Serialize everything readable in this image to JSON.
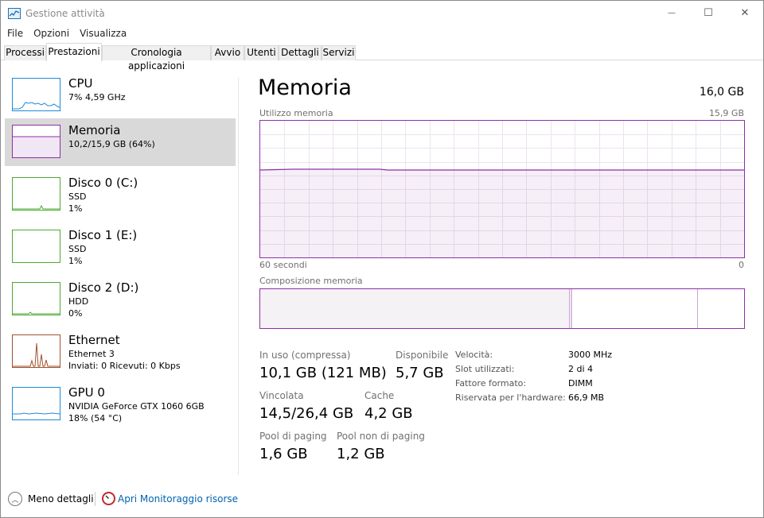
{
  "window": {
    "title": "Gestione attività",
    "controls": {
      "minimize": "—",
      "maximize": "☐",
      "close": "✕"
    }
  },
  "menu": [
    "File",
    "Opzioni",
    "Visualizza"
  ],
  "tabs": [
    {
      "label": "Processi",
      "active": false
    },
    {
      "label": "Prestazioni",
      "active": true
    },
    {
      "label": "Cronologia applicazioni",
      "active": false
    },
    {
      "label": "Avvio",
      "active": false
    },
    {
      "label": "Utenti",
      "active": false
    },
    {
      "label": "Dettagli",
      "active": false
    },
    {
      "label": "Servizi",
      "active": false
    }
  ],
  "sidebar": {
    "items": [
      {
        "name": "cpu",
        "title": "CPU",
        "line1": "7% 4,59 GHz",
        "line2": "",
        "line3": "",
        "color": "#1f8ad6",
        "selected": false
      },
      {
        "name": "memory",
        "title": "Memoria",
        "line1": "10,2/15,9 GB (64%)",
        "line2": "",
        "line3": "",
        "color": "#8e2ea6",
        "selected": true,
        "usage_fraction": 0.64
      },
      {
        "name": "disk-0",
        "title": "Disco 0 (C:)",
        "line1": "SSD",
        "line2": "1%",
        "line3": "",
        "color": "#4ca832",
        "selected": false
      },
      {
        "name": "disk-1",
        "title": "Disco 1 (E:)",
        "line1": "SSD",
        "line2": "1%",
        "line3": "",
        "color": "#4ca832",
        "selected": false
      },
      {
        "name": "disk-2",
        "title": "Disco 2 (D:)",
        "line1": "HDD",
        "line2": "0%",
        "line3": "",
        "color": "#4ca832",
        "selected": false
      },
      {
        "name": "ethernet",
        "title": "Ethernet",
        "line1": "Ethernet 3",
        "line2": "Inviati: 0 Ricevuti: 0 Kbps",
        "line3": "",
        "color": "#a0522d",
        "selected": false
      },
      {
        "name": "gpu-0",
        "title": "GPU 0",
        "line1": "NVIDIA GeForce GTX 1060 6GB",
        "line2": "18% (54 °C)",
        "line3": "",
        "color": "#1f8ad6",
        "selected": false
      }
    ]
  },
  "main": {
    "title": "Memoria",
    "total": "16,0 GB",
    "graph": {
      "label": "Utilizzo memoria",
      "max_label": "15,9 GB",
      "x_left_label": "60 secondi",
      "x_right_label": "0",
      "usage_fraction": 0.64,
      "color": "#8e2ea6"
    },
    "composition": {
      "label": "Composizione memoria",
      "in_use_fraction": 0.64,
      "modified_fraction": 0.004,
      "standby_fraction": 0.26
    },
    "stats": {
      "in_use_label": "In uso (compressa)",
      "in_use_value": "10,1 GB (121 MB)",
      "available_label": "Disponibile",
      "available_value": "5,7 GB",
      "committed_label": "Vincolata",
      "committed_value": "14,5/26,4 GB",
      "cached_label": "Cache",
      "cached_value": "4,2 GB",
      "paged_label": "Pool di paging",
      "paged_value": "1,6 GB",
      "nonpaged_label": "Pool non di paging",
      "nonpaged_value": "1,2 GB"
    },
    "info": [
      {
        "label": "Velocità:",
        "value": "3000 MHz"
      },
      {
        "label": "Slot utilizzati:",
        "value": "2 di 4"
      },
      {
        "label": "Fattore formato:",
        "value": "DIMM"
      },
      {
        "label": "Riservata per l'hardware:",
        "value": "66,9 MB"
      }
    ]
  },
  "footer": {
    "less_details": "Meno dettagli",
    "resource_monitor": "Apri Monitoraggio risorse"
  }
}
